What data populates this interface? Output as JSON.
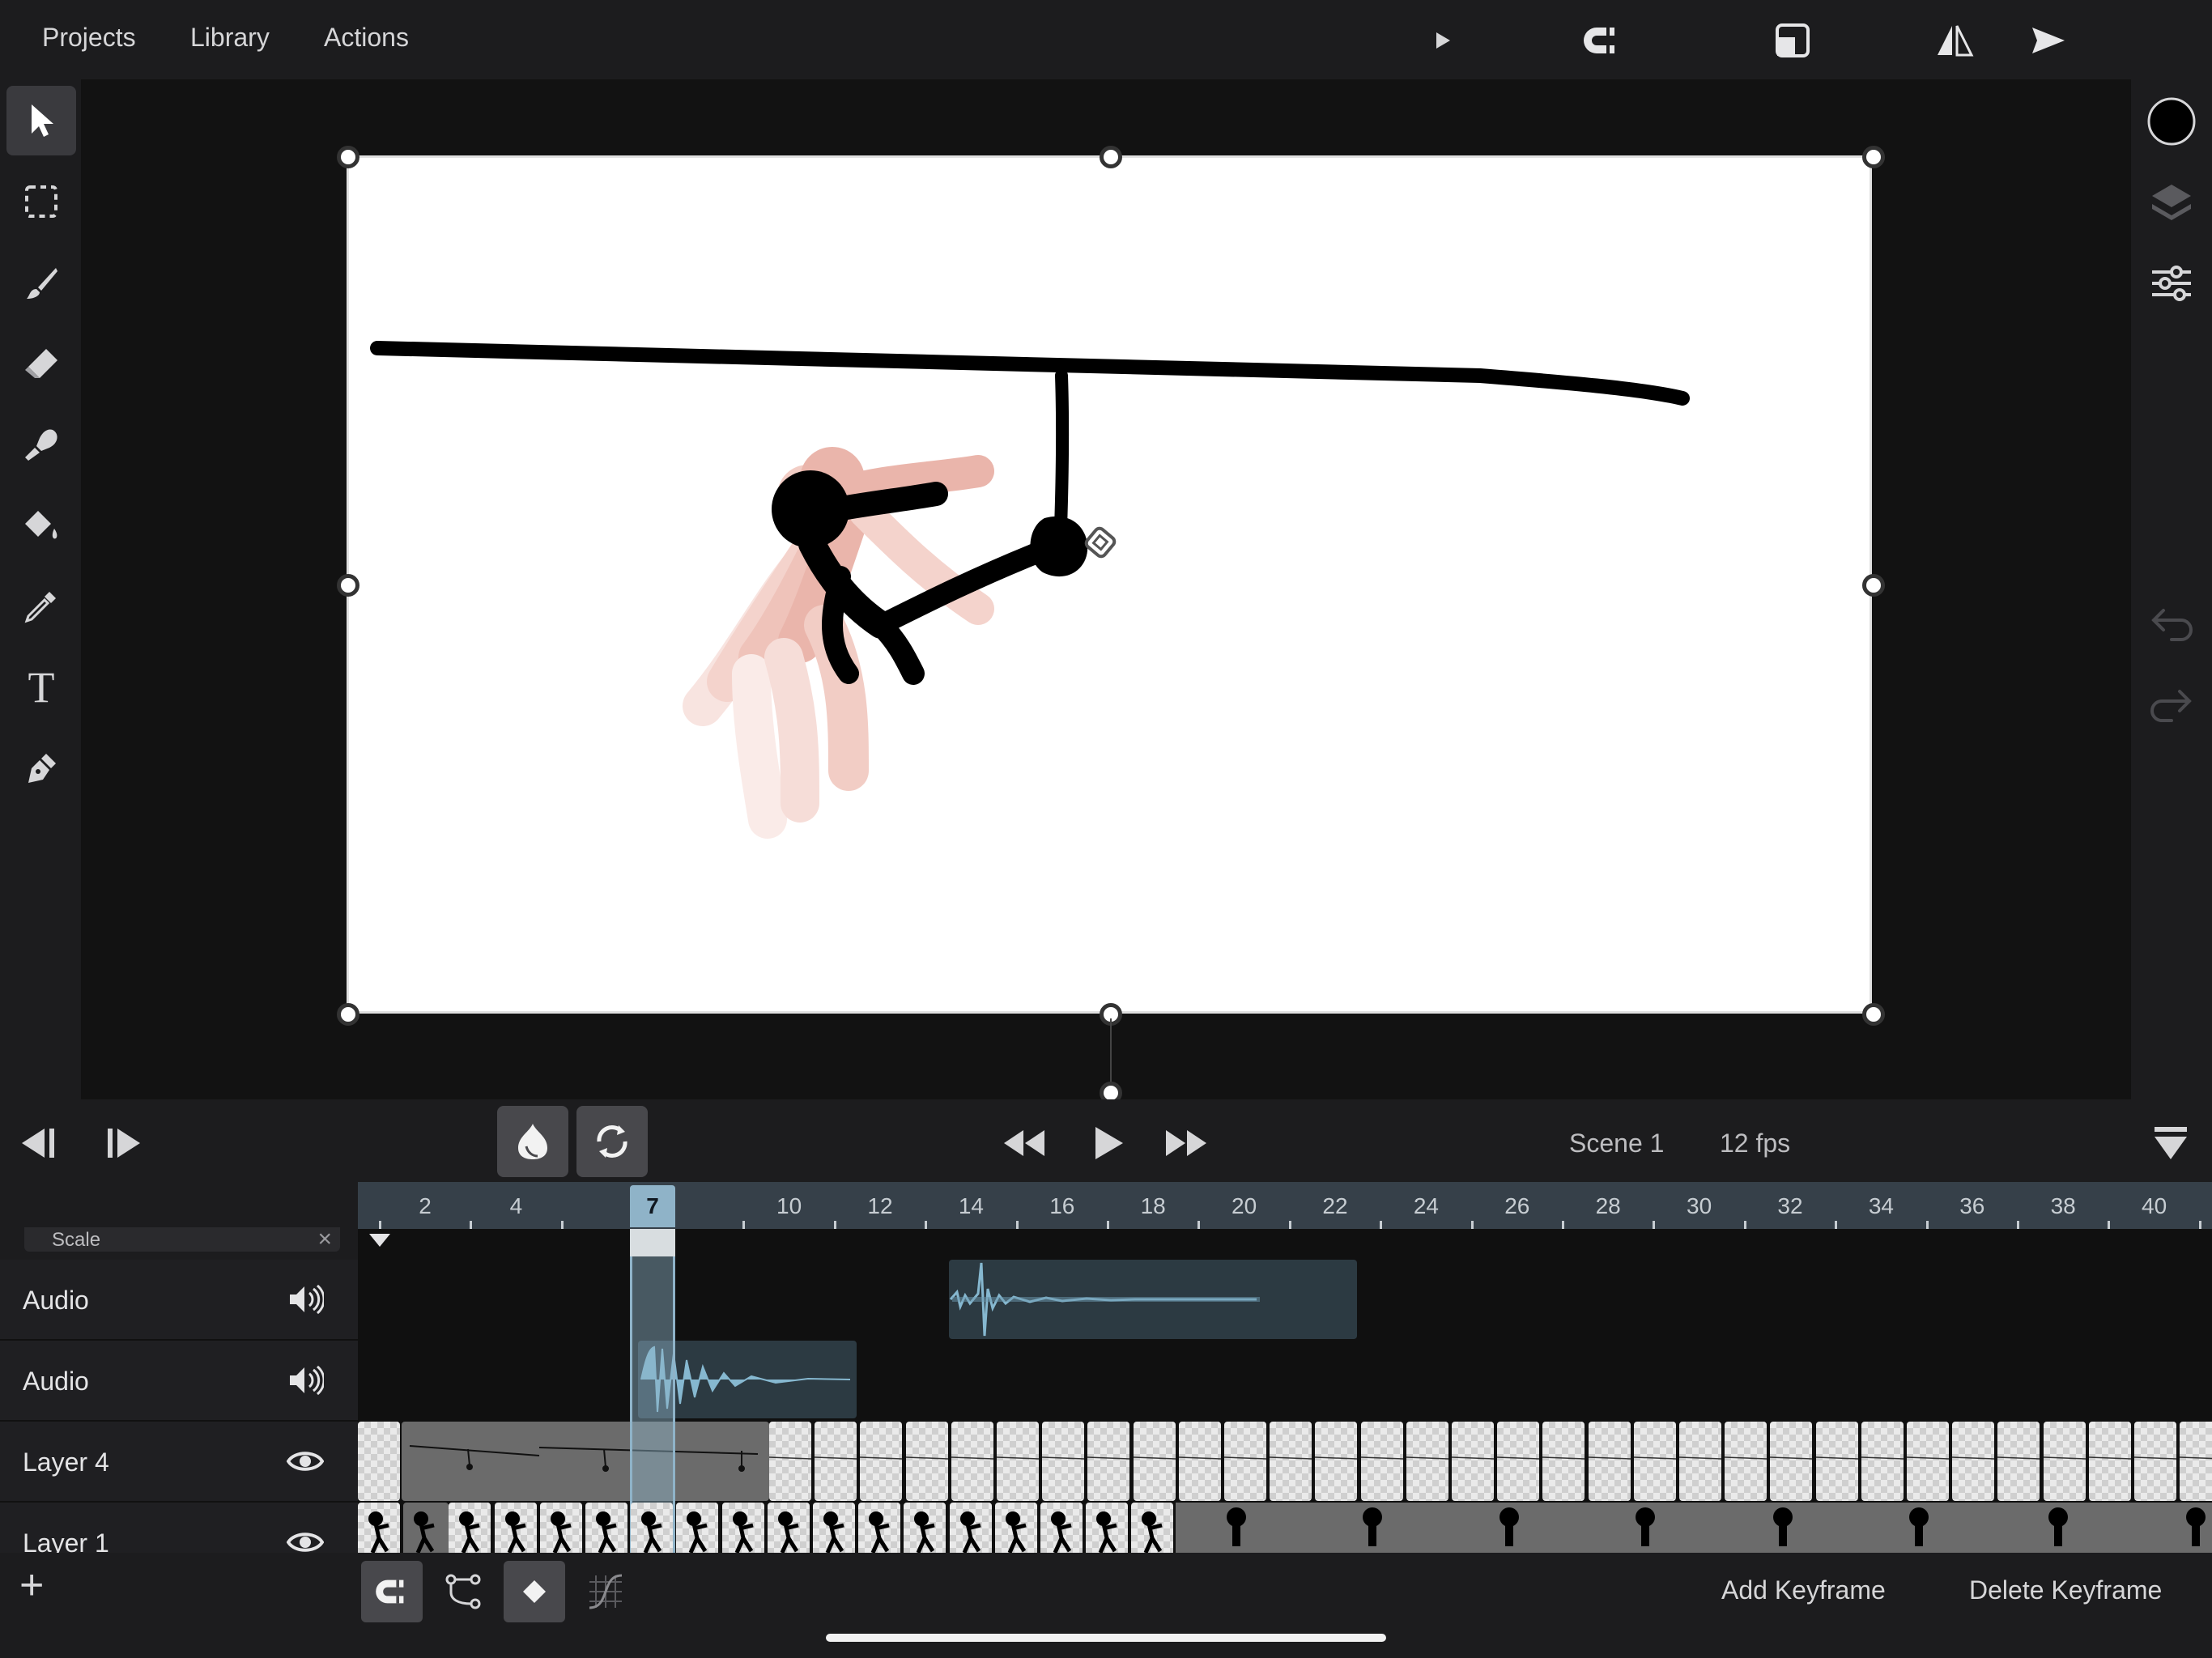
{
  "menu": {
    "projects": "Projects",
    "library": "Library",
    "actions": "Actions"
  },
  "top_icons": [
    "play-icon",
    "magnet-icon",
    "canvas-size-icon",
    "flip-icon",
    "send-icon"
  ],
  "tools": [
    "select-arrow-icon",
    "marquee-select-icon",
    "brush-icon",
    "eraser-icon",
    "smudge-icon",
    "paint-bucket-icon",
    "eyedropper-icon",
    "text-icon",
    "pen-icon"
  ],
  "text_tool_glyph": "T",
  "right_tools": [
    "color-swatch-icon",
    "layers-icon",
    "adjustments-icon",
    "undo-icon",
    "redo-icon"
  ],
  "transport": {
    "scene": "Scene 1",
    "fps": "12 fps"
  },
  "ruler": {
    "labels": [
      "2",
      "4",
      "7",
      "10",
      "12",
      "14",
      "16",
      "18",
      "20",
      "22",
      "24",
      "26",
      "28",
      "30",
      "32",
      "34",
      "36",
      "38",
      "40"
    ],
    "current_frame": "7"
  },
  "property_header": {
    "label": "Scale",
    "close": "×"
  },
  "tracks": [
    {
      "name": "Audio",
      "icon": "speaker-icon"
    },
    {
      "name": "Audio",
      "icon": "speaker-icon"
    },
    {
      "name": "Layer 4",
      "icon": "eye-icon"
    },
    {
      "name": "Layer 1",
      "icon": "eye-icon"
    }
  ],
  "bottom": {
    "add": "+",
    "add_keyframe": "Add Keyframe",
    "delete_keyframe": "Delete Keyframe"
  },
  "colors": {
    "accent": "#8fb3c8",
    "onion_skin": "#d46a5a",
    "background": "#1c1c1e"
  }
}
